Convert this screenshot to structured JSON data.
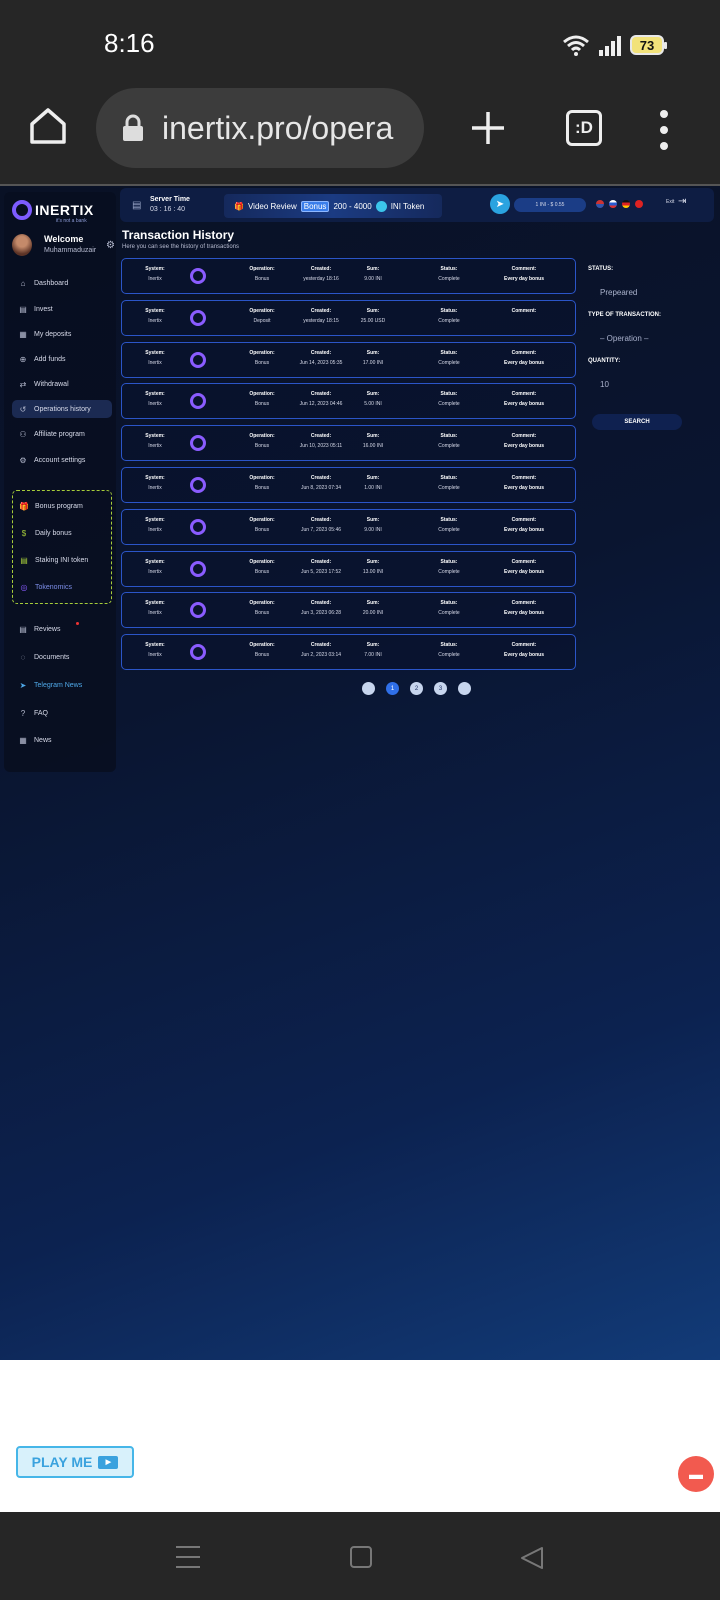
{
  "status_bar": {
    "time": "8:16",
    "battery": "73"
  },
  "browser": {
    "url": "inertix.pro/opera",
    "tabs_label": ":D"
  },
  "site": {
    "logo": "INERTIX",
    "logo_sub": "it's not a bank",
    "welcome": "Welcome",
    "username": "Muhammaduzair",
    "server_time_label": "Server Time",
    "server_time": "03 : 16 : 40",
    "video_review": "Video Review",
    "bonus_tag": "Bonus",
    "bonus_range": "200 - 4000",
    "token": "INI Token",
    "price": "1 INI - $ 0.55",
    "exit": "Exit",
    "nav": [
      {
        "label": "Dashboard",
        "icon": "home-icon"
      },
      {
        "label": "Invest",
        "icon": "invest-icon"
      },
      {
        "label": "My deposits",
        "icon": "deposits-icon"
      },
      {
        "label": "Add funds",
        "icon": "add-funds-icon"
      },
      {
        "label": "Withdrawal",
        "icon": "withdrawal-icon"
      },
      {
        "label": "Operations history",
        "icon": "history-icon"
      },
      {
        "label": "Affiliate program",
        "icon": "affiliate-icon"
      },
      {
        "label": "Account settings",
        "icon": "settings-icon"
      }
    ],
    "promo": [
      {
        "label": "Bonus program"
      },
      {
        "label": "Daily bonus"
      },
      {
        "label": "Staking INI token"
      },
      {
        "label": "Tokenomics"
      }
    ],
    "nav2": [
      {
        "label": "Reviews"
      },
      {
        "label": "Documents"
      },
      {
        "label": "Telegram News"
      },
      {
        "label": "FAQ"
      },
      {
        "label": "News"
      }
    ]
  },
  "history": {
    "title": "Transaction History",
    "subtitle": "Here you can see the history of transactions",
    "headers": {
      "system": "System:",
      "operation": "Operation:",
      "created": "Created:",
      "sum": "Sum:",
      "status": "Status:",
      "comment": "Comment:"
    },
    "rows": [
      {
        "system": "Inertix",
        "operation": "Bonus",
        "created": "yesterday 18:16",
        "sum": "9.00 INI",
        "status": "Complete",
        "comment": "Every day bonus"
      },
      {
        "system": "Inertix",
        "operation": "Deposit",
        "created": "yesterday 18:15",
        "sum": "25.00 USD",
        "status": "Complete",
        "comment": ""
      },
      {
        "system": "Inertix",
        "operation": "Bonus",
        "created": "Jun 14, 2023 05:35",
        "sum": "17.00 INI",
        "status": "Complete",
        "comment": "Every day bonus"
      },
      {
        "system": "Inertix",
        "operation": "Bonus",
        "created": "Jun 12, 2023 04:46",
        "sum": "5.00 INI",
        "status": "Complete",
        "comment": "Every day bonus"
      },
      {
        "system": "Inertix",
        "operation": "Bonus",
        "created": "Jun 10, 2023 05:11",
        "sum": "16.00 INI",
        "status": "Complete",
        "comment": "Every day bonus"
      },
      {
        "system": "Inertix",
        "operation": "Bonus",
        "created": "Jun 8, 2023 07:34",
        "sum": "1.00 INI",
        "status": "Complete",
        "comment": "Every day bonus"
      },
      {
        "system": "Inertix",
        "operation": "Bonus",
        "created": "Jun 7, 2023 05:46",
        "sum": "9.00 INI",
        "status": "Complete",
        "comment": "Every day bonus"
      },
      {
        "system": "Inertix",
        "operation": "Bonus",
        "created": "Jun 5, 2023 17:52",
        "sum": "13.00 INI",
        "status": "Complete",
        "comment": "Every day bonus"
      },
      {
        "system": "Inertix",
        "operation": "Bonus",
        "created": "Jun 3, 2023 06:28",
        "sum": "20.00 INI",
        "status": "Complete",
        "comment": "Every day bonus"
      },
      {
        "system": "Inertix",
        "operation": "Bonus",
        "created": "Jun 2, 2023 03:14",
        "sum": "7.00 INI",
        "status": "Complete",
        "comment": "Every day bonus"
      }
    ],
    "pages": [
      "1",
      "2",
      "3"
    ]
  },
  "filters": {
    "status_label": "STATUS:",
    "status_value": "Prepeared",
    "type_label": "TYPE OF TRANSACTION:",
    "type_value": "– Operation –",
    "qty_label": "QUANTITY:",
    "qty_value": "10",
    "search": "SEARCH"
  },
  "bottom": {
    "play_me": "PLAY ME"
  }
}
